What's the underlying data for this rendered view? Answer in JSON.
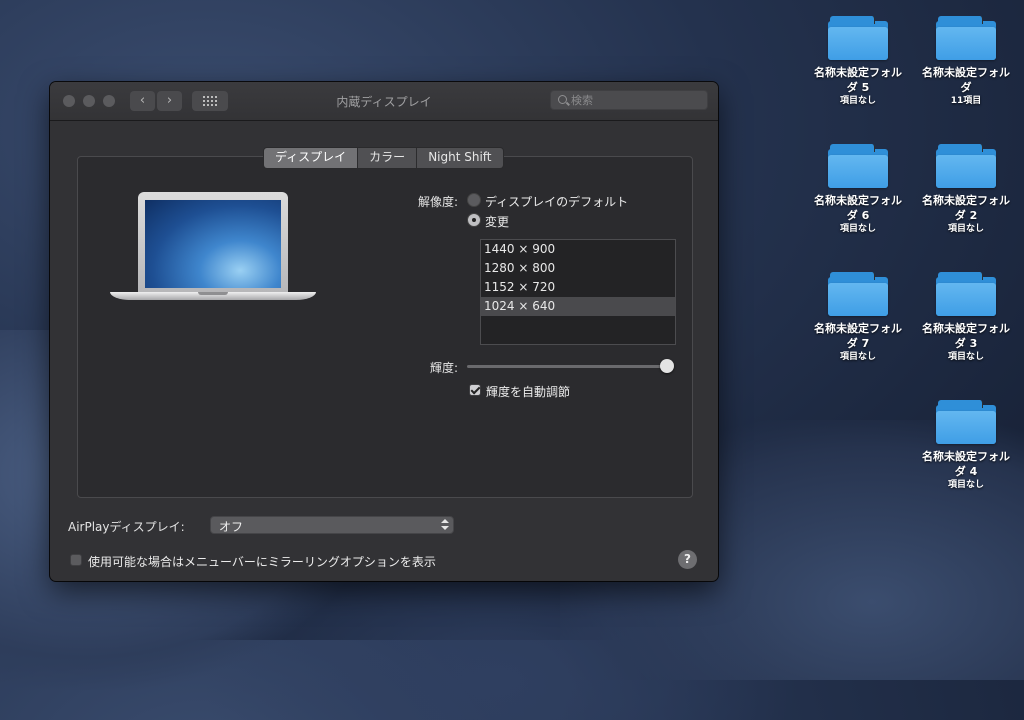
{
  "desktop": {
    "folders": [
      {
        "name_line1": "名称未設定フォル",
        "name_line2": "ダ 5",
        "sub": "項目なし"
      },
      {
        "name_line1": "名称未設定フォル",
        "name_line2": "ダ",
        "sub": "11項目"
      },
      {
        "name_line1": "名称未設定フォル",
        "name_line2": "ダ 6",
        "sub": "項目なし"
      },
      {
        "name_line1": "名称未設定フォル",
        "name_line2": "ダ 2",
        "sub": "項目なし"
      },
      {
        "name_line1": "名称未設定フォル",
        "name_line2": "ダ 7",
        "sub": "項目なし"
      },
      {
        "name_line1": "名称未設定フォル",
        "name_line2": "ダ 3",
        "sub": "項目なし"
      },
      {
        "name_line1": "名称未設定フォル",
        "name_line2": "ダ 4",
        "sub": "項目なし"
      }
    ]
  },
  "window": {
    "title": "内蔵ディスプレイ",
    "search_placeholder": "検索",
    "nav": {
      "back": "‹",
      "forward": "›"
    },
    "tabs": [
      {
        "label": "ディスプレイ",
        "active": true
      },
      {
        "label": "カラー",
        "active": false
      },
      {
        "label": "Night Shift",
        "active": false
      }
    ],
    "resolution": {
      "label": "解像度:",
      "option_default": "ディスプレイのデフォルト",
      "option_scaled": "変更",
      "selected": "scaled",
      "list": [
        "1440 × 900",
        "1280 × 800",
        "1152 × 720",
        "1024 × 640"
      ],
      "selected_item": "1024 × 640"
    },
    "brightness": {
      "label": "輝度:",
      "value": 1.0,
      "auto_label": "輝度を自動調節",
      "auto_checked": true
    },
    "airplay": {
      "label": "AirPlayディスプレイ:",
      "value": "オフ"
    },
    "mirror_option": {
      "label": "使用可能な場合はメニューバーにミラーリングオプションを表示",
      "checked": false
    },
    "help_label": "?"
  }
}
